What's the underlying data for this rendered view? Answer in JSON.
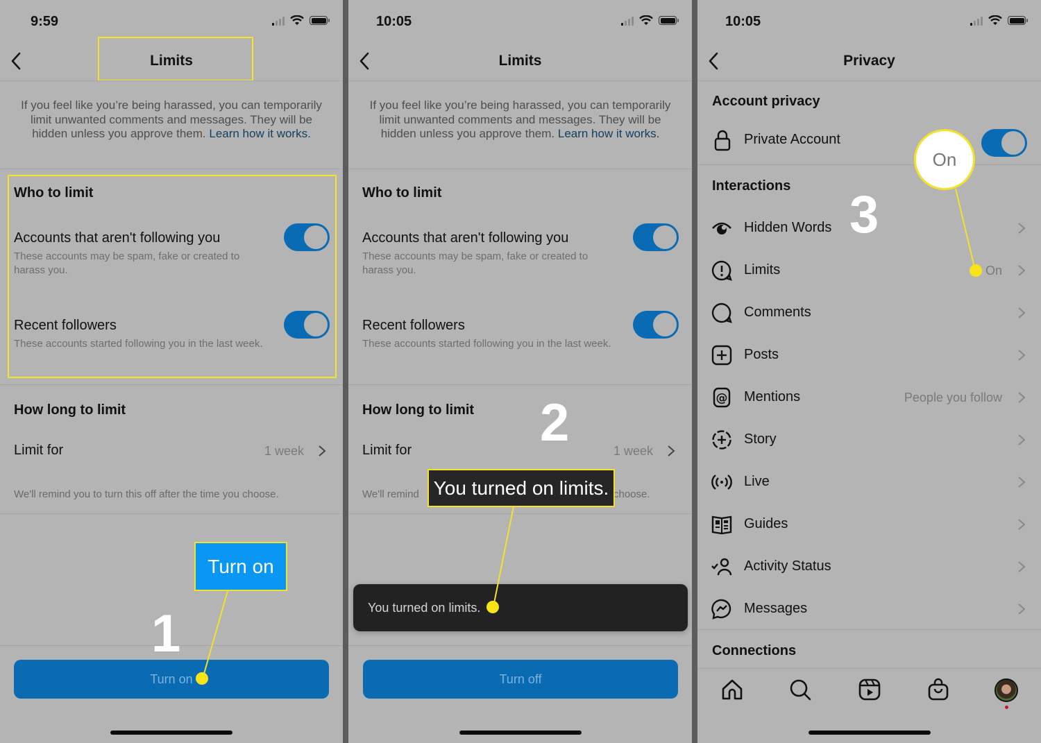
{
  "colors": {
    "accent_blue": "#0a6bb3",
    "annotation_yellow": "#f2e22a",
    "callout_blue": "#0a97f3",
    "toast_bg": "#222222",
    "link": "#133e5e",
    "notification": "#c4182f"
  },
  "panel1": {
    "status_time": "9:59",
    "title": "Limits",
    "intro_text": "If you feel like you’re being harassed, you can temporarily limit unwanted comments and messages. They will be hidden unless you approve them. ",
    "intro_link": "Learn how it works.",
    "who_heading": "Who to limit",
    "options": [
      {
        "title": "Accounts that aren't following you",
        "subtitle": "These accounts may be spam, fake or created to harass you.",
        "enabled": true
      },
      {
        "title": "Recent followers",
        "subtitle": "These accounts started following you in the last week.",
        "enabled": true
      }
    ],
    "how_long_heading": "How long to limit",
    "limit_for_label": "Limit for",
    "limit_for_value": "1 week",
    "reminder_note": "We'll remind you to turn this off after the time you choose.",
    "button_label": "Turn on",
    "annotation": {
      "step": "1",
      "callout": "Turn on"
    }
  },
  "panel2": {
    "status_time": "10:05",
    "title": "Limits",
    "intro_text": "If you feel like you’re being harassed, you can temporarily limit unwanted comments and messages. They will be hidden unless you approve them. ",
    "intro_link": "Learn how it works.",
    "who_heading": "Who to limit",
    "options": [
      {
        "title": "Accounts that aren't following you",
        "subtitle": "These accounts may be spam, fake or created to harass you.",
        "enabled": true
      },
      {
        "title": "Recent followers",
        "subtitle": "These accounts started following you in the last week.",
        "enabled": true
      }
    ],
    "how_long_heading": "How long to limit",
    "limit_for_label": "Limit for",
    "limit_for_value": "1 week",
    "reminder_note_left": "We'll remind",
    "reminder_note_right": "choose.",
    "toast_text": "You turned on limits.",
    "button_label": "Turn off",
    "annotation": {
      "step": "2",
      "callout": "You turned on limits."
    }
  },
  "panel3": {
    "status_time": "10:05",
    "title": "Privacy",
    "account_privacy_heading": "Account privacy",
    "private_account_label": "Private Account",
    "private_account_enabled": true,
    "interactions_heading": "Interactions",
    "items": [
      {
        "icon": "hidden-words-icon",
        "label": "Hidden Words",
        "value": ""
      },
      {
        "icon": "limits-icon",
        "label": "Limits",
        "value": "On"
      },
      {
        "icon": "comments-icon",
        "label": "Comments",
        "value": ""
      },
      {
        "icon": "posts-icon",
        "label": "Posts",
        "value": ""
      },
      {
        "icon": "mentions-icon",
        "label": "Mentions",
        "value": "People you follow"
      },
      {
        "icon": "story-icon",
        "label": "Story",
        "value": ""
      },
      {
        "icon": "live-icon",
        "label": "Live",
        "value": ""
      },
      {
        "icon": "guides-icon",
        "label": "Guides",
        "value": ""
      },
      {
        "icon": "activity-status-icon",
        "label": "Activity Status",
        "value": ""
      },
      {
        "icon": "messages-icon",
        "label": "Messages",
        "value": ""
      }
    ],
    "connections_heading": "Connections",
    "tabbar": [
      "home-icon",
      "search-icon",
      "reels-icon",
      "shop-icon",
      "profile-avatar"
    ],
    "annotation": {
      "step": "3",
      "callout": "On"
    }
  }
}
